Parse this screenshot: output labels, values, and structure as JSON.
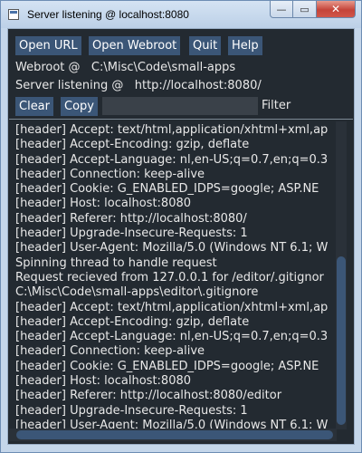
{
  "window": {
    "title": "Server listening @ localhost:8080",
    "minimize_glyph": "—",
    "maximize_glyph": "▭",
    "close_glyph": "✕"
  },
  "toolbar": {
    "open_url": "Open URL",
    "open_webroot": "Open Webroot",
    "quit": "Quit",
    "help": "Help"
  },
  "info": {
    "webroot": "Webroot @   C:\\Misc\\Code\\small-apps",
    "server": "Server listening @   http://localhost:8080/"
  },
  "controls": {
    "clear": "Clear",
    "copy": "Copy",
    "filter_value": "",
    "filter_label": "Filter"
  },
  "log": {
    "lines": [
      "[header] Accept: text/html,application/xhtml+xml,ap",
      "[header] Accept-Encoding: gzip, deflate",
      "[header] Accept-Language: nl,en-US;q=0.7,en;q=0.3",
      "[header] Connection: keep-alive",
      "[header] Cookie: G_ENABLED_IDPS=google; ASP.NE",
      "[header] Host: localhost:8080",
      "[header] Referer: http://localhost:8080/",
      "[header] Upgrade-Insecure-Requests: 1",
      "[header] User-Agent: Mozilla/5.0 (Windows NT 6.1; W",
      "Spinning thread to handle request",
      "Request recieved from 127.0.0.1 for /editor/.gitignor",
      "C:\\Misc\\Code\\small-apps\\editor\\.gitignore",
      "[header] Accept: text/html,application/xhtml+xml,ap",
      "[header] Accept-Encoding: gzip, deflate",
      "[header] Accept-Language: nl,en-US;q=0.7,en;q=0.3",
      "[header] Connection: keep-alive",
      "[header] Cookie: G_ENABLED_IDPS=google; ASP.NE",
      "[header] Host: localhost:8080",
      "[header] Referer: http://localhost:8080/editor",
      "[header] Upgrade-Insecure-Requests: 1",
      "[header] User-Agent: Mozilla/5.0 (Windows NT 6.1; W"
    ],
    "vertical_scroll_position": 0.98
  }
}
